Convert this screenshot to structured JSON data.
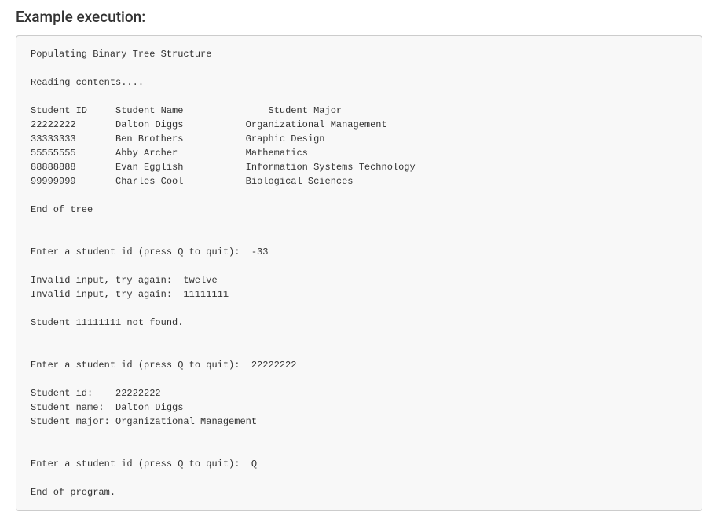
{
  "heading": "Example execution:",
  "console": {
    "line1": "Populating Binary Tree Structure",
    "line2": "Reading contents....",
    "header": {
      "id": "Student ID",
      "name": "Student Name",
      "major": "Student Major"
    },
    "rows": [
      {
        "id": "22222222",
        "name": "Dalton Diggs",
        "major": "Organizational Management"
      },
      {
        "id": "33333333",
        "name": "Ben Brothers",
        "major": "Graphic Design"
      },
      {
        "id": "55555555",
        "name": "Abby Archer",
        "major": "Mathematics"
      },
      {
        "id": "88888888",
        "name": "Evan Egglish",
        "major": "Information Systems Technology"
      },
      {
        "id": "99999999",
        "name": "Charles Cool",
        "major": "Biological Sciences"
      }
    ],
    "end_tree": "End of tree",
    "prompt1": "Enter a student id (press Q to quit):  -33",
    "invalid1": "Invalid input, try again:  twelve",
    "invalid2": "Invalid input, try again:  11111111",
    "notfound": "Student 11111111 not found.",
    "prompt2": "Enter a student id (press Q to quit):  22222222",
    "result_id": "Student id:    22222222",
    "result_name": "Student name:  Dalton Diggs",
    "result_major": "Student major: Organizational Management",
    "prompt3": "Enter a student id (press Q to quit):  Q",
    "end_program": "End of program."
  }
}
